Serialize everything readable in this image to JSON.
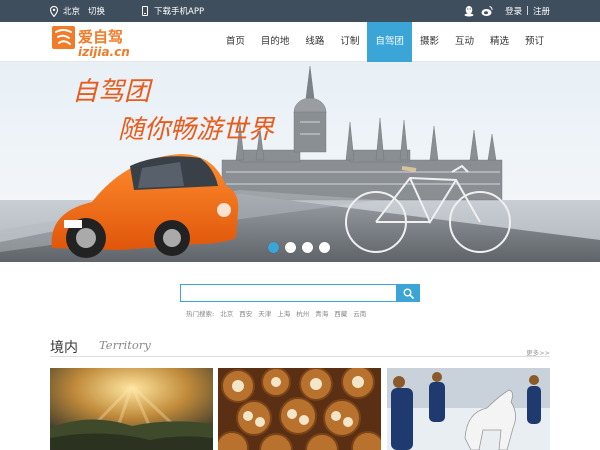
{
  "topbar": {
    "city": "北京",
    "switch_label": "切换",
    "app_download": "下载手机APP",
    "login": "登录",
    "separator": "|",
    "register": "注册"
  },
  "header": {
    "logo_text": "爱自驾",
    "logo_domain": "izijia.cn",
    "nav": [
      "首页",
      "目的地",
      "线路",
      "订制",
      "自驾团",
      "摄影",
      "互动",
      "精选",
      "预订"
    ],
    "active_nav": "自驾团"
  },
  "banner": {
    "line1": "自驾团",
    "line2": "随你畅游世界",
    "slide_count": 4,
    "active_slide": 1
  },
  "search": {
    "value": "",
    "hot_label": "热门搜索:",
    "hot_terms": [
      "北京",
      "西安",
      "天津",
      "上海",
      "杭州",
      "青海",
      "西藏",
      "云南"
    ]
  },
  "section": {
    "title_cn": "境内",
    "title_en": "Territory",
    "more": "更多>>"
  },
  "colors": {
    "accent": "#3aa5d6",
    "topbar": "#3f4e5c",
    "logo_orange": "#f07c2a",
    "banner_text": "#e85c1c"
  }
}
